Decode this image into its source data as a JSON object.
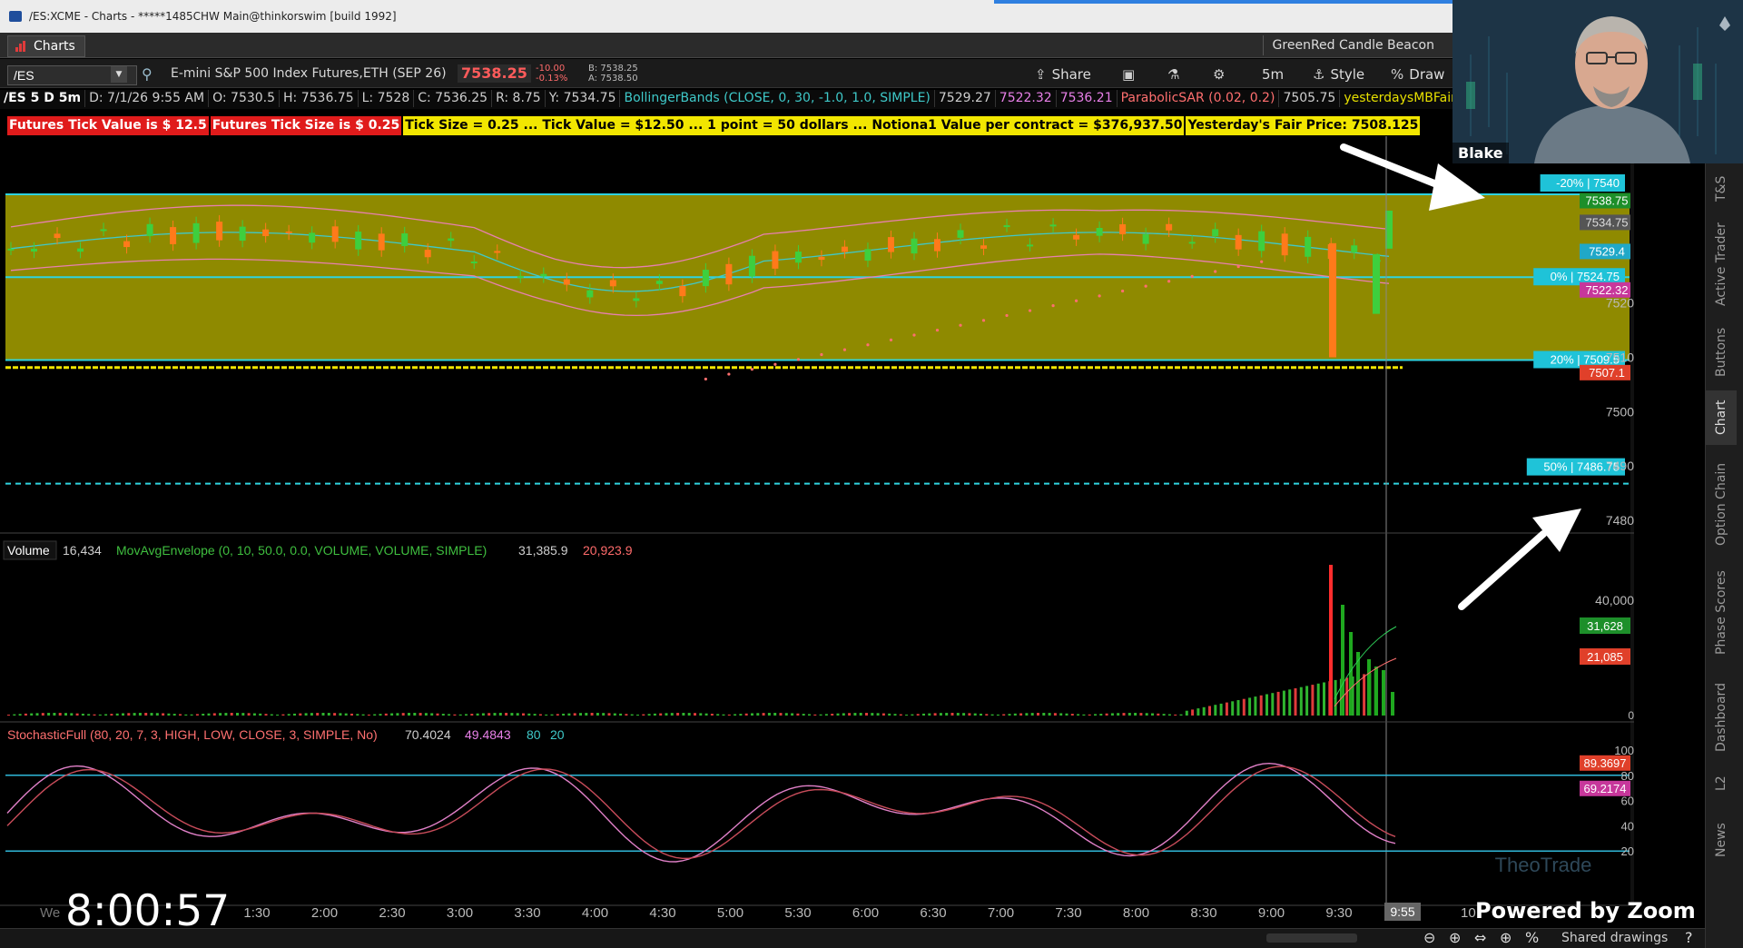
{
  "window": {
    "title": "/ES:XCME - Charts - *****1485CHW Main@thinkorswim [build 1992]"
  },
  "tabs": {
    "active": "Charts",
    "right_label": "GreenRed Candle Beacon"
  },
  "toolbar": {
    "symbol": "/ES",
    "description": "E-mini S&P 500 Index Futures,ETH (SEP 26)",
    "last": "7538.25",
    "net_change": "-10.00",
    "pct_change": "-0.13%",
    "bid": "B: 7538.25",
    "ask": "A: 7538.50",
    "share_label": "Share",
    "aggregation": "5m",
    "style_label": "Style",
    "draw_label": "Draw"
  },
  "info_row": [
    {
      "text": "/ES 5 D 5m",
      "color": "#ffffff"
    },
    {
      "text": "D: 7/1/26 9:55 AM",
      "color": "#cfcfcf"
    },
    {
      "text": "O: 7530.5",
      "color": "#cfcfcf"
    },
    {
      "text": "H: 7536.75",
      "color": "#cfcfcf"
    },
    {
      "text": "L: 7528",
      "color": "#cfcfcf"
    },
    {
      "text": "C: 7536.25",
      "color": "#cfcfcf"
    },
    {
      "text": "R: 8.75",
      "color": "#cfcfcf"
    },
    {
      "text": "Y: 7534.75",
      "color": "#cfcfcf"
    },
    {
      "text": "BollingerBands (CLOSE, 0, 30, -1.0, 1.0, SIMPLE)",
      "color": "#3fc9c9"
    },
    {
      "text": "7529.27",
      "color": "#cfcfcf"
    },
    {
      "text": "7522.32",
      "color": "#e880e8"
    },
    {
      "text": "7536.21",
      "color": "#e880e8"
    },
    {
      "text": "ParabolicSAR (0.02, 0.2)",
      "color": "#ff6f6f"
    },
    {
      "text": "7505.75",
      "color": "#cfcfcf"
    },
    {
      "text": "yesterdaysMBFairPr",
      "color": "#e7e000"
    }
  ],
  "tick_banner": [
    {
      "text": "Futures Tick Value is $ 12.5",
      "bg": "#e01b1b",
      "fg": "#ffffff"
    },
    {
      "text": "Futures Tick Size is $ 0.25",
      "bg": "#e01b1b",
      "fg": "#ffffff"
    },
    {
      "text": "Tick Size =  0.25 ... Tick Value =  $12.50 ... 1 point = 50 dollars ... Notiona1 Value per contract =  $376,937.50",
      "bg": "#f2e600",
      "fg": "#000000"
    },
    {
      "text": "Yesterday's Fair Price: 7508.125",
      "bg": "#f2e600",
      "fg": "#000000"
    }
  ],
  "price_panel": {
    "y_ticks": [
      "7520",
      "7510",
      "7500",
      "7490",
      "7480"
    ],
    "y_range": [
      7474,
      7547
    ],
    "zone": {
      "top": 7540,
      "bottom": 7509.5,
      "color": "#8f8a00"
    },
    "fair_price_line": 7508.125,
    "levels": [
      {
        "label": "-20% | 7540",
        "value": 7540
      },
      {
        "label": "0% | 7524.75",
        "value": 7524.75
      },
      {
        "label": "20% | 7509.5",
        "value": 7509.5
      },
      {
        "label": "50% | 7486.75",
        "value": 7486.75
      }
    ],
    "price_bubbles": [
      {
        "text": "7538.75",
        "value": 7538.75,
        "bg": "#1d8f2a",
        "fg": "#ffffff"
      },
      {
        "text": "7534.75",
        "value": 7534.75,
        "bg": "#555555",
        "fg": "#dddddd"
      },
      {
        "text": "7529.4",
        "value": 7529.4,
        "bg": "#20a8c8",
        "fg": "#ffffff"
      },
      {
        "text": "7522.32",
        "value": 7522.32,
        "bg": "#c7379b",
        "fg": "#ffffff"
      },
      {
        "text": "7507.1",
        "value": 7507.1,
        "bg": "#e0402a",
        "fg": "#ffffff"
      }
    ]
  },
  "volume_panel": {
    "title": "Volume",
    "value": "16,434",
    "study": "MovAvgEnvelope (0, 10, 50.0, 0.0, VOLUME, VOLUME, SIMPLE)",
    "v1": "31,385.9",
    "v2": "20,923.9",
    "y_tick": "40,000",
    "bubble_green": "31,628",
    "bubble_red": "21,085",
    "zero": "0"
  },
  "stoch_panel": {
    "title": "StochasticFull (80, 20, 7, 3, HIGH, LOW, CLOSE, 3, SIMPLE, No)",
    "k": "70.4024",
    "d": "49.4843",
    "ob": "80",
    "os": "20",
    "y_ticks": [
      "100",
      "80",
      "60",
      "40",
      "20"
    ],
    "bubble_k": "89.3697",
    "bubble_d": "69.2174"
  },
  "time_axis": [
    "1:30",
    "2:00",
    "2:30",
    "3:00",
    "3:30",
    "4:00",
    "4:30",
    "5:00",
    "5:30",
    "6:00",
    "6:30",
    "7:00",
    "7:30",
    "8:00",
    "8:30",
    "9:00",
    "9:30"
  ],
  "time_axis_left_partial": "We",
  "time_axis_cursor": "9:55",
  "time_axis_right_partial": "10",
  "side_tabs": [
    "T&S",
    "Active Trader",
    "Buttons",
    "Chart",
    "Option Chain",
    "Phase Scores",
    "Dashboard",
    "L2",
    "News"
  ],
  "overlay": {
    "clock": "8:00:57",
    "zoom_label": "Powered by Zoom",
    "camera_name": "Blake",
    "watermark": "TheoTrade"
  },
  "bottom_bar": {
    "shared_drawings": "Shared drawings"
  }
}
